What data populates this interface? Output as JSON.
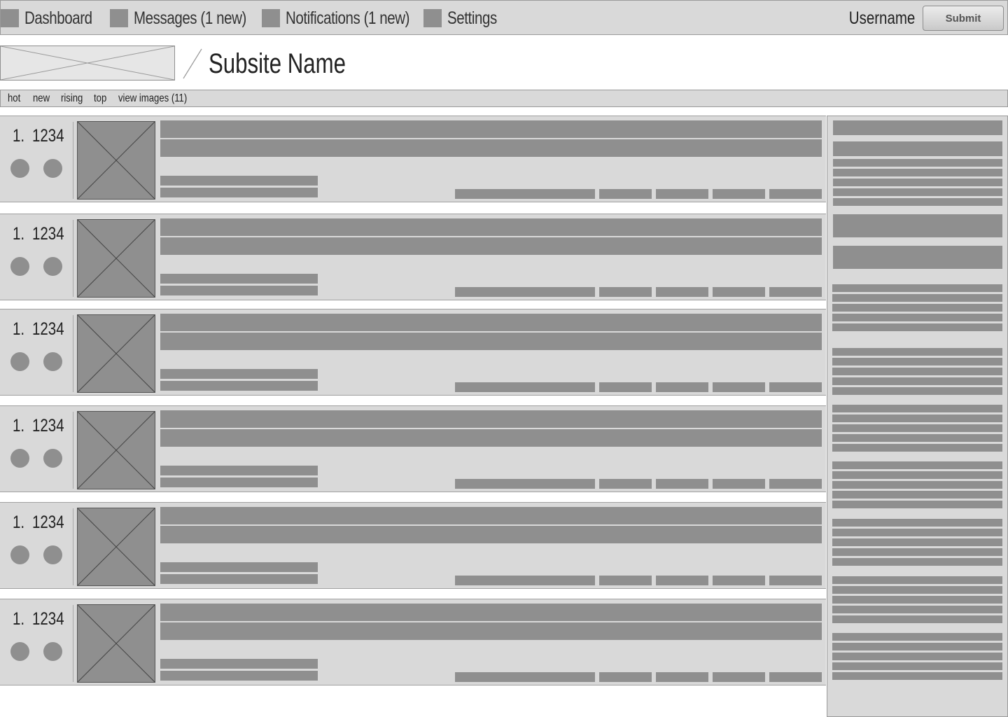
{
  "topnav": {
    "items": [
      {
        "label": "Dashboard",
        "icon": "square-icon"
      },
      {
        "label": "Messages (1 new)",
        "icon": "square-icon"
      },
      {
        "label": "Notifications (1 new)",
        "icon": "square-icon"
      },
      {
        "label": "Settings",
        "icon": "square-icon"
      }
    ],
    "username": "Username",
    "submit_label": "Submit"
  },
  "header": {
    "site_name": "Subsite Name",
    "logo_icon": "image-placeholder-icon"
  },
  "tabs": [
    "hot",
    "new",
    "rising",
    "top",
    "view images (11)"
  ],
  "posts": [
    {
      "rank": "1.",
      "score": "1234"
    },
    {
      "rank": "1.",
      "score": "1234"
    },
    {
      "rank": "1.",
      "score": "1234"
    },
    {
      "rank": "1.",
      "score": "1234"
    },
    {
      "rank": "1.",
      "score": "1234"
    },
    {
      "rank": "1.",
      "score": "1234"
    }
  ],
  "colors": {
    "panel": "#d9d9d9",
    "placeholder": "#8f8f8f",
    "border": "#9a9a9a"
  }
}
